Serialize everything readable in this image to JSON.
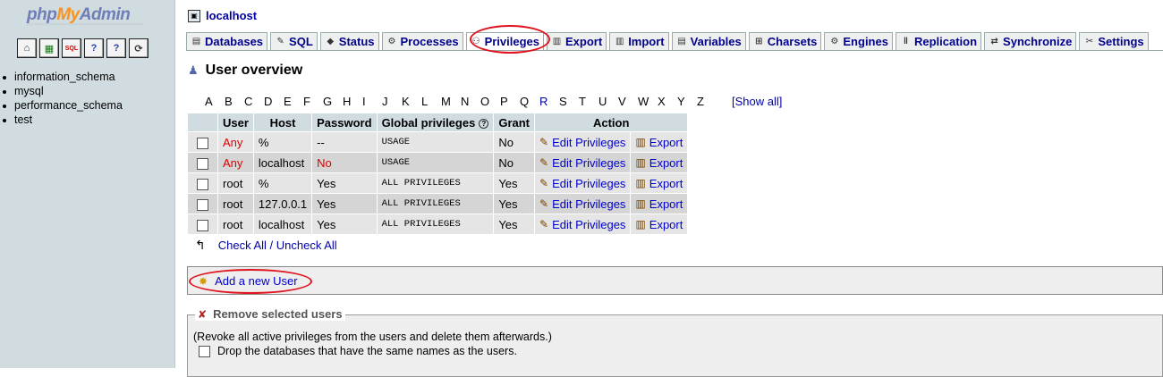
{
  "logo": {
    "php": "php",
    "my": "My",
    "admin": "Admin"
  },
  "sidebar": {
    "databases": [
      "information_schema",
      "mysql",
      "performance_schema",
      "test"
    ],
    "icons": [
      "home-icon",
      "grid-icon",
      "sql-icon",
      "help-icon",
      "docs-icon",
      "reload-icon"
    ]
  },
  "server": {
    "name": "localhost"
  },
  "tabs": [
    {
      "label": "Databases",
      "icon": "databases-icon"
    },
    {
      "label": "SQL",
      "icon": "sql-icon"
    },
    {
      "label": "Status",
      "icon": "status-icon"
    },
    {
      "label": "Processes",
      "icon": "processes-icon"
    },
    {
      "label": "Privileges",
      "icon": "privileges-icon",
      "active": true
    },
    {
      "label": "Export",
      "icon": "export-icon"
    },
    {
      "label": "Import",
      "icon": "import-icon"
    },
    {
      "label": "Variables",
      "icon": "variables-icon"
    },
    {
      "label": "Charsets",
      "icon": "charsets-icon"
    },
    {
      "label": "Engines",
      "icon": "engines-icon"
    },
    {
      "label": "Replication",
      "icon": "replication-icon"
    },
    {
      "label": "Synchronize",
      "icon": "synchronize-icon"
    },
    {
      "label": "Settings",
      "icon": "settings-icon"
    }
  ],
  "overview": {
    "title": "User overview"
  },
  "alphabet": [
    "A",
    "B",
    "C",
    "D",
    "E",
    "F",
    "G",
    "H",
    "I",
    "J",
    "K",
    "L",
    "M",
    "N",
    "O",
    "P",
    "Q",
    "R",
    "S",
    "T",
    "U",
    "V",
    "W",
    "X",
    "Y",
    "Z"
  ],
  "alphabet_active": "R",
  "show_all": "[Show all]",
  "table": {
    "headers": {
      "user": "User",
      "host": "Host",
      "password": "Password",
      "global": "Global privileges",
      "grant": "Grant",
      "action": "Action"
    },
    "rows": [
      {
        "user": "Any",
        "host": "%",
        "password": "--",
        "global": "USAGE",
        "grant": "No",
        "edit": "Edit Privileges",
        "export": "Export"
      },
      {
        "user": "Any",
        "host": "localhost",
        "password": "No",
        "global": "USAGE",
        "grant": "No",
        "edit": "Edit Privileges",
        "export": "Export"
      },
      {
        "user": "root",
        "host": "%",
        "password": "Yes",
        "global": "ALL PRIVILEGES",
        "grant": "Yes",
        "edit": "Edit Privileges",
        "export": "Export"
      },
      {
        "user": "root",
        "host": "127.0.0.1",
        "password": "Yes",
        "global": "ALL PRIVILEGES",
        "grant": "Yes",
        "edit": "Edit Privileges",
        "export": "Export"
      },
      {
        "user": "root",
        "host": "localhost",
        "password": "Yes",
        "global": "ALL PRIVILEGES",
        "grant": "Yes",
        "edit": "Edit Privileges",
        "export": "Export"
      }
    ]
  },
  "check_all": "Check All / Uncheck All",
  "add_user": "Add a new User",
  "remove": {
    "legend": "Remove selected users",
    "description": "(Revoke all active privileges from the users and delete them afterwards.)",
    "drop_label": "Drop the databases that have the same names as the users."
  },
  "colors": {
    "sidebar_bg": "#d0dce0",
    "link": "#0000cc",
    "highlight_circle": "#e0141e",
    "red_text": "#dd0000"
  }
}
